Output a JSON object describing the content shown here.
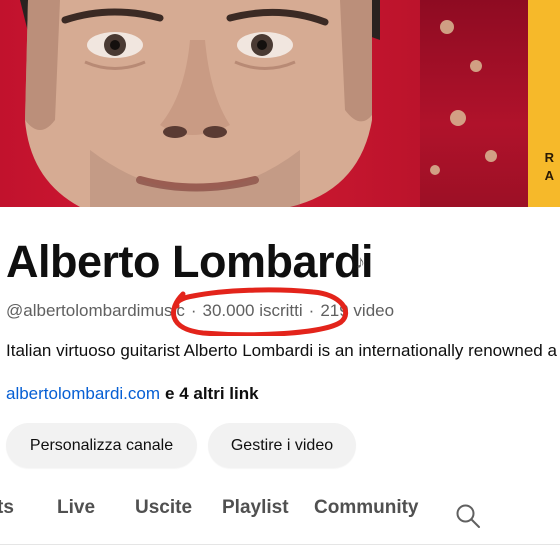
{
  "channel": {
    "name": "Alberto Lombardi",
    "handle": "@albertolombardimusic",
    "subscribers": "30.000 iscritti",
    "videos": "219 video",
    "separator": "·",
    "description": "Italian virtuoso guitarist Alberto Lombardi is an internationally renowned a",
    "link": "albertolombardi.com",
    "more_links": "e 4 altri link"
  },
  "buttons": {
    "customize": "Personalizza canale",
    "manage": "Gestire i video"
  },
  "tabs": [
    "ts",
    "Live",
    "Uscite",
    "Playlist",
    "Community"
  ],
  "icons": {
    "music_note": "music-note-icon",
    "search": "search-icon"
  },
  "banner": {
    "edge_text": [
      "R",
      "A"
    ]
  },
  "annotation": {
    "color": "#e3241b"
  },
  "colors": {
    "link": "#065fd4",
    "banner_red": "#c8172f",
    "banner_yellow": "#f6b92a"
  }
}
